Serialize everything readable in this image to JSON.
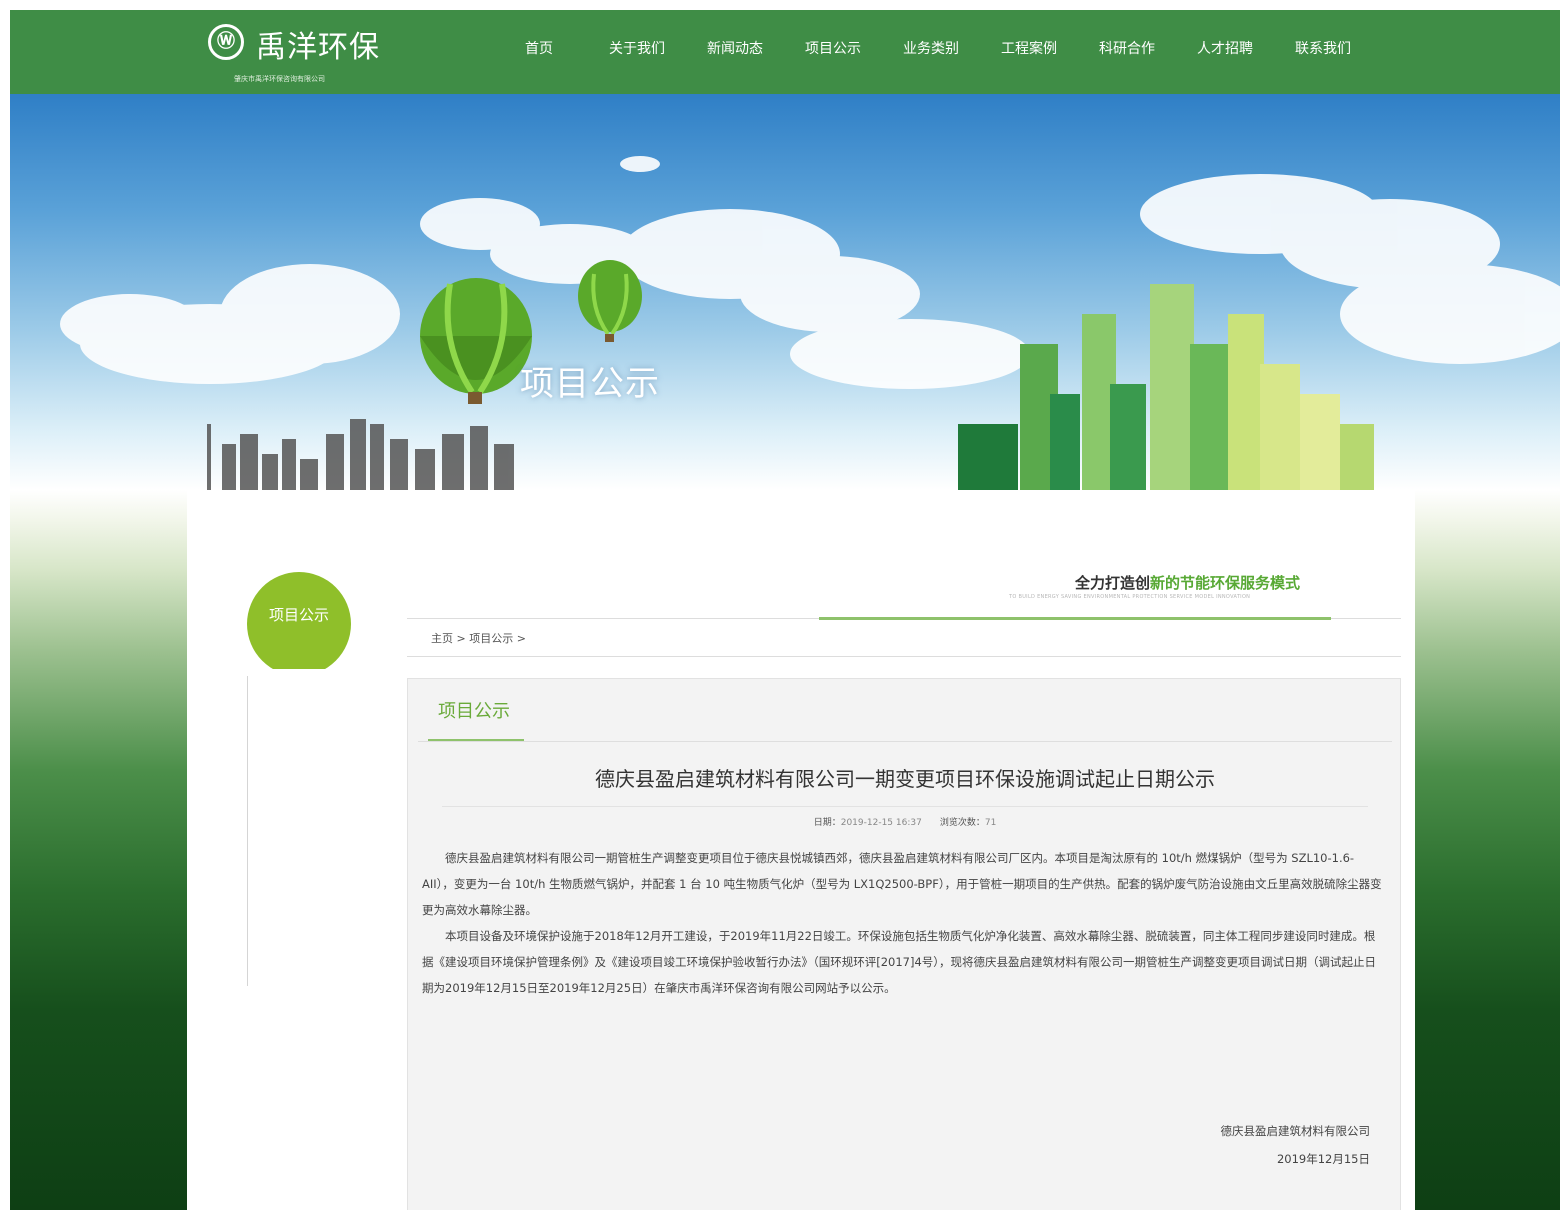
{
  "header": {
    "logo_glyph": "Ⓦ",
    "logo_title": "禹洋环保",
    "logo_subtitle": "肇庆市禹洋环保咨询有限公司",
    "nav": [
      "首页",
      "关于我们",
      "新闻动态",
      "项目公示",
      "业务类别",
      "工程案例",
      "科研合作",
      "人才招聘",
      "联系我们"
    ]
  },
  "banner": {
    "title": "项目公示"
  },
  "sidebar": {
    "label": "项目公示"
  },
  "slogan": {
    "prefix": "全力打造创",
    "highlight": "新的节能环保服务模式",
    "english": "TO BUILD ENERGY SAVING ENVIRONMENTAL PROTECTION SERVICE MODEL INNOVATION"
  },
  "breadcrumb": "主页 > 项目公示 >",
  "panel": {
    "title": "项目公示"
  },
  "article": {
    "title": "德庆县盈启建筑材料有限公司一期变更项目环保设施调试起止日期公示",
    "date_label": "日期：",
    "date": "2019-12-15 16:37",
    "views_label": "浏览次数：",
    "views": "71",
    "para1": "德庆县盈启建筑材料有限公司一期管桩生产调整变更项目位于德庆县悦城镇西郊，德庆县盈启建筑材料有限公司厂区内。本项目是淘汰原有的 10t/h 燃煤锅炉（型号为 SZL10-1.6-AII），变更为一台 10t/h 生物质燃气锅炉，并配套 1 台 10 吨生物质气化炉（型号为 LX1Q2500-BPF），用于管桩一期项目的生产供热。配套的锅炉废气防治设施由文丘里高效脱硫除尘器变更为高效水幕除尘器。",
    "para2": "本项目设备及环境保护设施于2018年12月开工建设，于2019年11月22日竣工。环保设施包括生物质气化炉净化装置、高效水幕除尘器、脱硫装置，同主体工程同步建设同时建成。根据《建设项目环境保护管理条例》及《建设项目竣工环境保护验收暂行办法》（国环规环评[2017]4号），现将德庆县盈启建筑材料有限公司一期管桩生产调整变更项目调试日期（调试起止日期为2019年12月15日至2019年12月25日）在肇庆市禹洋环保咨询有限公司网站予以公示。",
    "sign_company": "德庆县盈启建筑材料有限公司",
    "sign_date": "2019年12月15日"
  },
  "colors": {
    "header_green": "#3f8d46",
    "accent_green": "#6aaa3a",
    "circle_green": "#8fbf2a"
  }
}
